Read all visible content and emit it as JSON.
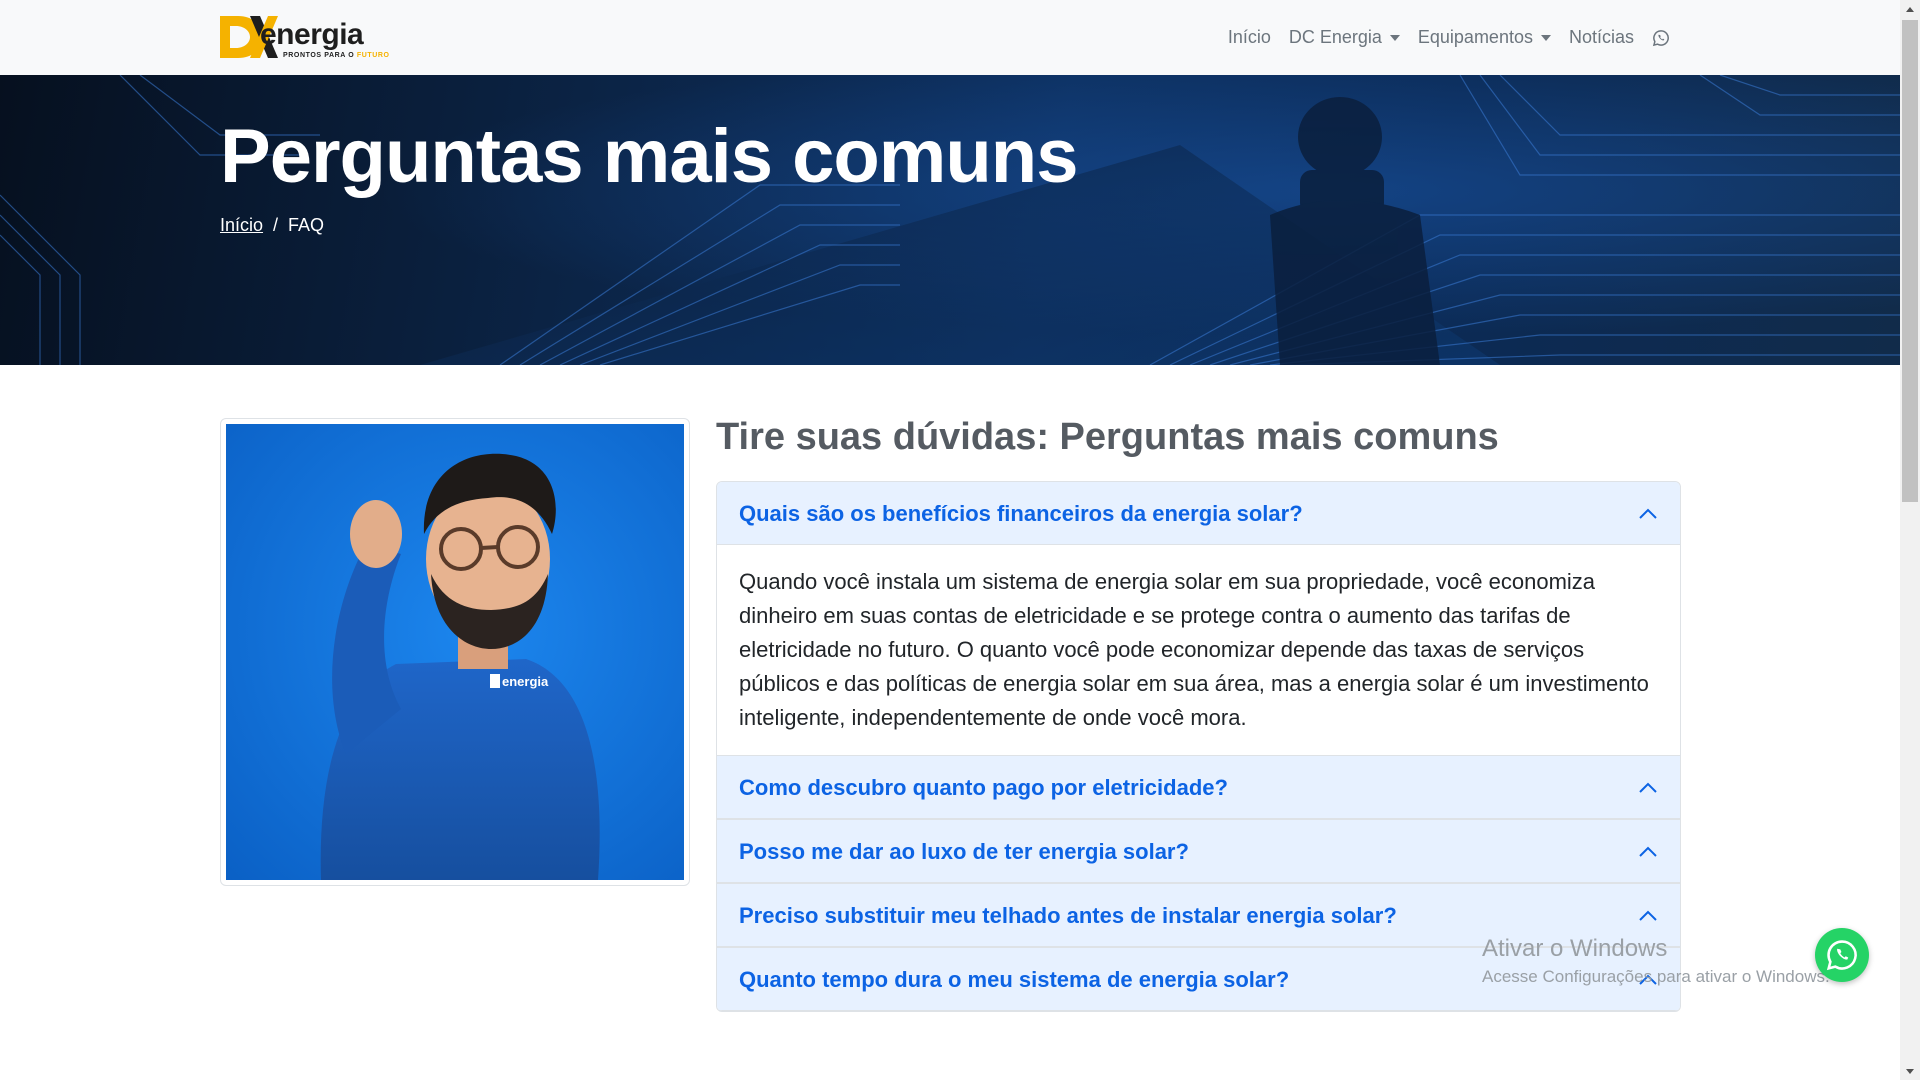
{
  "navbar": {
    "logo": {
      "word": "energia",
      "tag_prefix": "PRONTOS PARA O ",
      "tag_highlight": "FUTURO"
    },
    "links": {
      "inicio": "Início",
      "dc_energia": "DC Energia",
      "equipamentos": "Equipamentos",
      "noticias": "Notícias"
    }
  },
  "hero": {
    "title": "Perguntas mais comuns",
    "breadcrumb": {
      "home": "Início",
      "separator": "/",
      "current": "FAQ"
    }
  },
  "photo": {
    "shirt_logo": "energia"
  },
  "faq": {
    "heading": "Tire suas dúvidas: Perguntas mais comuns",
    "items": [
      {
        "question": "Quais são os benefícios financeiros da energia solar?",
        "answer": "Quando você instala um sistema de energia solar em sua propriedade, você economiza dinheiro em suas contas de eletricidade e se protege contra o aumento das tarifas de eletricidade no futuro. O quanto você pode economizar depende das taxas de serviços públicos e das políticas de energia solar em sua área, mas a energia solar é um investimento inteligente, independentemente de onde você mora."
      },
      {
        "question": "Como descubro quanto pago por eletricidade?"
      },
      {
        "question": "Posso me dar ao luxo de ter energia solar?"
      },
      {
        "question": "Preciso substituir meu telhado antes de instalar energia solar?"
      },
      {
        "question": "Quanto tempo dura o meu sistema de energia solar?"
      }
    ]
  },
  "watermark": {
    "title": "Ativar o Windows",
    "subtitle": "Acesse Configurações para ativar o Windows."
  },
  "colors": {
    "accent": "#0c63e4",
    "accordion_header_bg": "#e7f1ff",
    "logo_yellow": "#f5b200",
    "whatsapp": "#25d366"
  },
  "icons": {
    "nav_whatsapp": "whatsapp-icon",
    "floating_whatsapp": "whatsapp-icon",
    "accordion_toggle": "chevron-up-icon"
  }
}
